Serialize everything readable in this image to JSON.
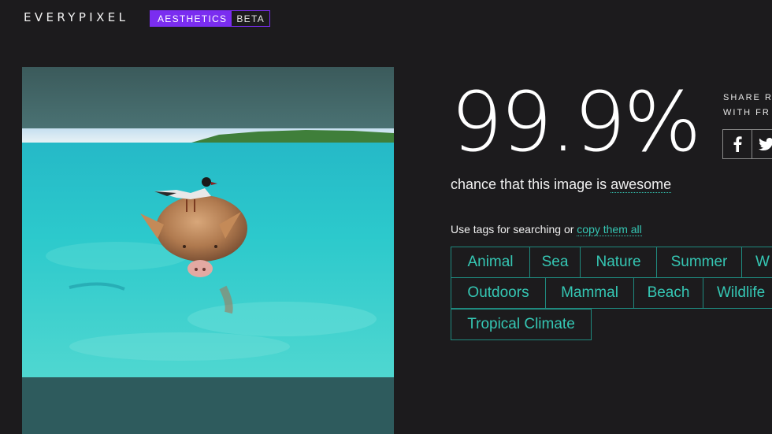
{
  "header": {
    "logo": "EVERYPIXEL",
    "badge_primary": "AESTHETICS",
    "badge_secondary": "BETA"
  },
  "result": {
    "score": "99.9%",
    "caption_prefix": "chance that this image is ",
    "caption_highlight": "awesome"
  },
  "share": {
    "line1": "SHARE R",
    "line2": "WITH FR",
    "facebook_icon": "facebook-icon",
    "twitter_icon": "twitter-icon"
  },
  "tags_intro": {
    "text": "Use tags for searching or ",
    "link": "copy them all"
  },
  "tags": [
    "Animal",
    "Sea",
    "Nature",
    "Summer",
    "W",
    "Outdoors",
    "Mammal",
    "Beach",
    "Wildlife",
    "Tropical Climate"
  ],
  "colors": {
    "background": "#1c1b1d",
    "accent_purple": "#7a2df0",
    "accent_teal": "#35c7b4",
    "tag_border": "#1f8a7f"
  }
}
